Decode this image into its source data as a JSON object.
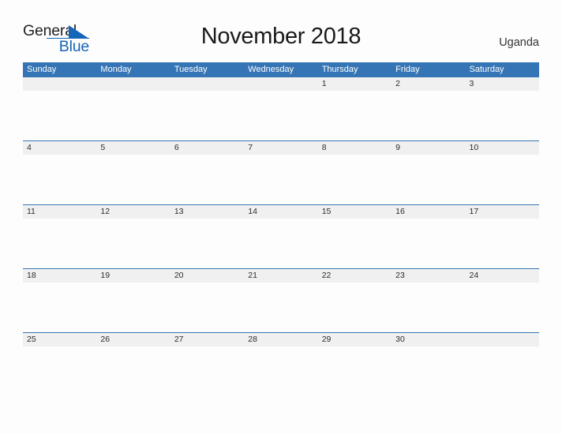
{
  "branding": {
    "name_part1": "General",
    "name_part2": "Blue",
    "accent_color": "#1565b8",
    "mark": "triangle-flag-icon"
  },
  "header": {
    "title": "November 2018",
    "region": "Uganda"
  },
  "calendar": {
    "month": "November",
    "year": "2018",
    "header_bg": "#3575b5",
    "date_band_bg": "#f0f0f0",
    "weekdays": [
      "Sunday",
      "Monday",
      "Tuesday",
      "Wednesday",
      "Thursday",
      "Friday",
      "Saturday"
    ],
    "weeks": [
      {
        "days": [
          "",
          "",
          "",
          "",
          "1",
          "2",
          "3"
        ]
      },
      {
        "days": [
          "4",
          "5",
          "6",
          "7",
          "8",
          "9",
          "10"
        ]
      },
      {
        "days": [
          "11",
          "12",
          "13",
          "14",
          "15",
          "16",
          "17"
        ]
      },
      {
        "days": [
          "18",
          "19",
          "20",
          "21",
          "22",
          "23",
          "24"
        ]
      },
      {
        "days": [
          "25",
          "26",
          "27",
          "28",
          "29",
          "30",
          ""
        ]
      }
    ]
  }
}
